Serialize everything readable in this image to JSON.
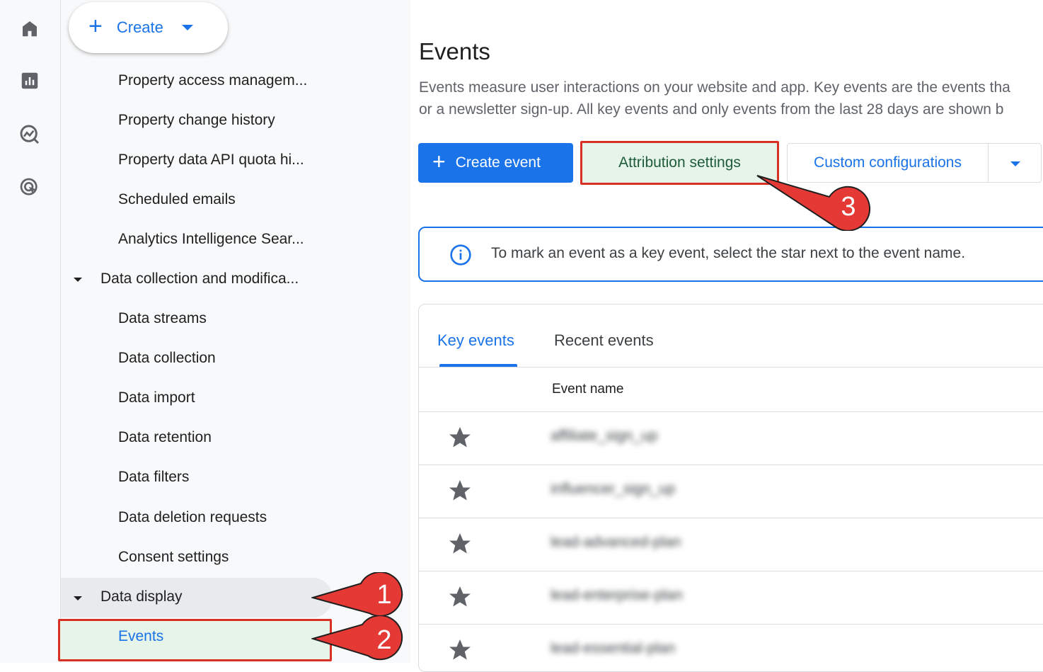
{
  "rail": {
    "icons": [
      "home-icon",
      "reports-icon",
      "explore-icon",
      "advertising-icon"
    ]
  },
  "create": {
    "label": "Create"
  },
  "nav": {
    "items_top": [
      "Property access managem...",
      "Property change history",
      "Property data API quota hi...",
      "Scheduled emails",
      "Analytics Intelligence Sear..."
    ],
    "group_data_collection": "Data collection and modifica...",
    "data_collection_items": [
      "Data streams",
      "Data collection",
      "Data import",
      "Data retention",
      "Data filters",
      "Data deletion requests",
      "Consent settings"
    ],
    "group_data_display": "Data display",
    "events": "Events"
  },
  "main": {
    "title": "Events",
    "desc_line1": "Events measure user interactions on your website and app. Key events are the events tha",
    "desc_line2": "or a newsletter sign-up. All key events and only events from the last 28 days are shown b",
    "create_event": "Create event",
    "attribution_settings": "Attribution settings",
    "custom_configurations": "Custom configurations",
    "info_text": "To mark an event as a key event, select the star next to the event name.",
    "tabs": [
      "Key events",
      "Recent events"
    ],
    "column_header": "Event name",
    "rows": [
      "affiliate_sign_up",
      "influencer_sign_up",
      "lead-advanced-plan",
      "lead-enterprise-plan",
      "lead-essential-plan"
    ]
  },
  "callouts": [
    "1",
    "2",
    "3"
  ],
  "colors": {
    "accent": "#1a73e8",
    "highlight_border": "#d93025",
    "highlight_fill": "#e6f4ea",
    "callout": "#e53935"
  }
}
